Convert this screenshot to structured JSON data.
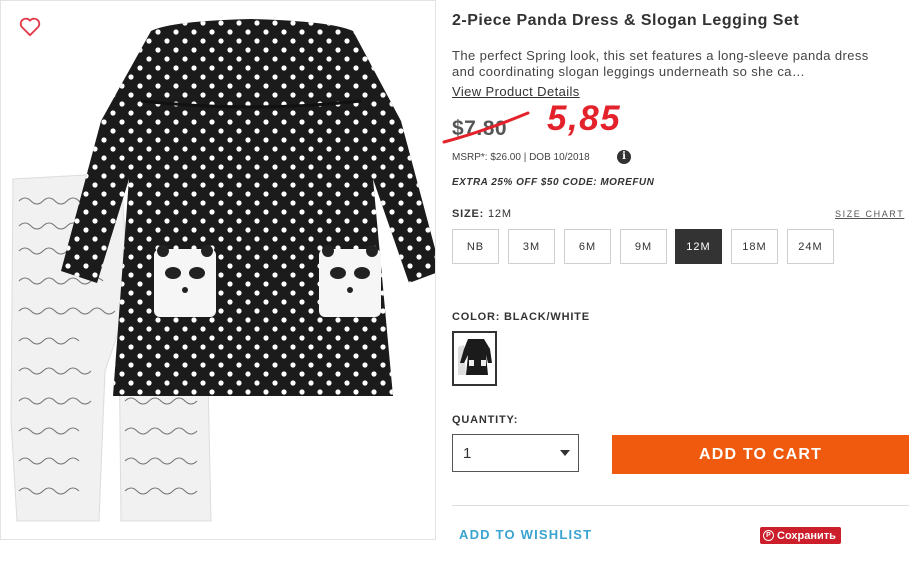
{
  "product": {
    "title": "2-Piece Panda Dress & Slogan Legging Set",
    "description": "The perfect Spring look, this set features a long-sleeve panda dress and coordinating slogan leggings underneath so she ca…",
    "view_details_label": "View Product Details",
    "old_price": "$7.80",
    "new_price": "5,85",
    "msrp": "MSRP*: $26.00 | DOB 10/2018",
    "info_icon": "i",
    "promo": "EXTRA 25% OFF $50 CODE: MOREFUN"
  },
  "size": {
    "label": "SIZE:",
    "selected": "12M",
    "chart_link": "SIZE CHART",
    "options": [
      "NB",
      "3M",
      "6M",
      "9M",
      "12M",
      "18M",
      "24M"
    ]
  },
  "color": {
    "label": "COLOR: BLACK/WHITE",
    "swatch_icon": "panda-outfit-swatch"
  },
  "quantity": {
    "label": "QUANTITY:",
    "value": "1"
  },
  "actions": {
    "add_to_cart": "ADD TO CART",
    "wishlist": "ADD TO WISHLIST",
    "save": "Сохранить",
    "save_icon": "P"
  },
  "colors": {
    "add_to_cart_bg": "#f05a0e",
    "new_price": "#e3222b",
    "wishlist_link": "#3aa3cf",
    "save_bg": "#cc1e2b",
    "selected_size_bg": "#333333"
  }
}
